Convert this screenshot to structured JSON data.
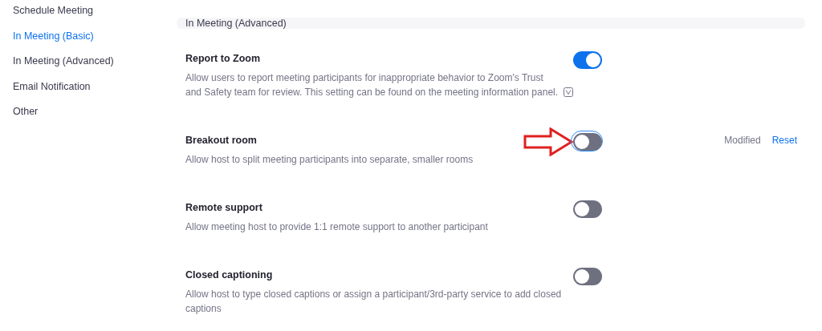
{
  "sidebar": {
    "items": [
      {
        "label": "Schedule Meeting",
        "selected": false
      },
      {
        "label": "In Meeting (Basic)",
        "selected": true
      },
      {
        "label": "In Meeting (Advanced)",
        "selected": false
      },
      {
        "label": "Email Notification",
        "selected": false
      },
      {
        "label": "Other",
        "selected": false
      }
    ]
  },
  "section": {
    "title": "In Meeting (Advanced)"
  },
  "settings": [
    {
      "title": "Report to Zoom",
      "description": "Allow users to report meeting participants for inappropriate behavior to Zoom's Trust and Safety team for review. This setting can be found on the meeting information panel.",
      "has_note_icon": true,
      "on": true
    },
    {
      "title": "Breakout room",
      "description": "Allow host to split meeting participants into separate, smaller rooms",
      "on": false,
      "focused": true,
      "pointed_at": true,
      "status": "Modified",
      "reset": "Reset"
    },
    {
      "title": "Remote support",
      "description": "Allow meeting host to provide 1:1 remote support to another participant",
      "on": false
    },
    {
      "title": "Closed captioning",
      "description": "Allow host to type closed captions or assign a participant/3rd-party service to add closed captions",
      "on": false
    }
  ]
}
